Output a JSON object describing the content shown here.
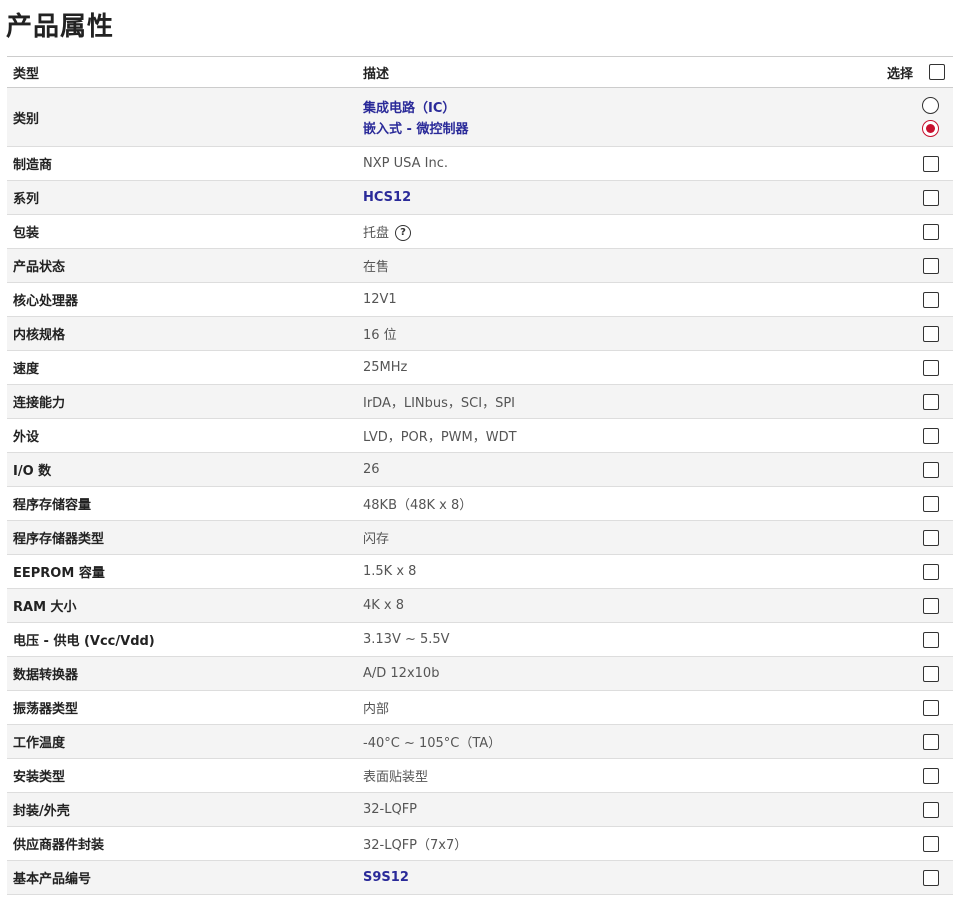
{
  "title": "产品属性",
  "table": {
    "headers": {
      "type": "类型",
      "description": "描述",
      "select": "选择"
    },
    "category": {
      "label": "类别",
      "links": [
        "集成电路（IC）",
        "嵌入式 - 微控制器"
      ]
    },
    "rows": [
      {
        "key": "制造商",
        "value": "NXP USA Inc.",
        "link": false
      },
      {
        "key": "系列",
        "value": "HCS12",
        "link": true
      },
      {
        "key": "包装",
        "value": "托盘",
        "link": false,
        "help_icon": "help-circle-icon",
        "help_glyph": "?"
      },
      {
        "key": "产品状态",
        "value": "在售",
        "link": false
      },
      {
        "key": "核心处理器",
        "value": "12V1",
        "link": false
      },
      {
        "key": "内核规格",
        "value": "16 位",
        "link": false
      },
      {
        "key": "速度",
        "value": "25MHz",
        "link": false
      },
      {
        "key": "连接能力",
        "value": "IrDA，LINbus，SCI，SPI",
        "link": false
      },
      {
        "key": "外设",
        "value": "LVD，POR，PWM，WDT",
        "link": false
      },
      {
        "key": "I/O 数",
        "value": "26",
        "link": false
      },
      {
        "key": "程序存储容量",
        "value": "48KB（48K x 8）",
        "link": false
      },
      {
        "key": "程序存储器类型",
        "value": "闪存",
        "link": false
      },
      {
        "key": "EEPROM 容量",
        "value": "1.5K x 8",
        "link": false
      },
      {
        "key": "RAM 大小",
        "value": "4K x 8",
        "link": false
      },
      {
        "key": "电压 - 供电 (Vcc/Vdd)",
        "value": "3.13V ~ 5.5V",
        "link": false
      },
      {
        "key": "数据转换器",
        "value": "A/D 12x10b",
        "link": false
      },
      {
        "key": "振荡器类型",
        "value": "内部",
        "link": false
      },
      {
        "key": "工作温度",
        "value": "-40°C ~ 105°C（TA）",
        "link": false
      },
      {
        "key": "安装类型",
        "value": "表面贴装型",
        "link": false
      },
      {
        "key": "封装/外壳",
        "value": "32-LQFP",
        "link": false
      },
      {
        "key": "供应商器件封装",
        "value": "32-LQFP（7x7）",
        "link": false
      },
      {
        "key": "基本产品编号",
        "value": "S9S12",
        "link": true
      }
    ]
  },
  "colors": {
    "link": "#2a2a99",
    "radio_selected": "#c8102e",
    "row_alt": "#f4f4f4"
  }
}
